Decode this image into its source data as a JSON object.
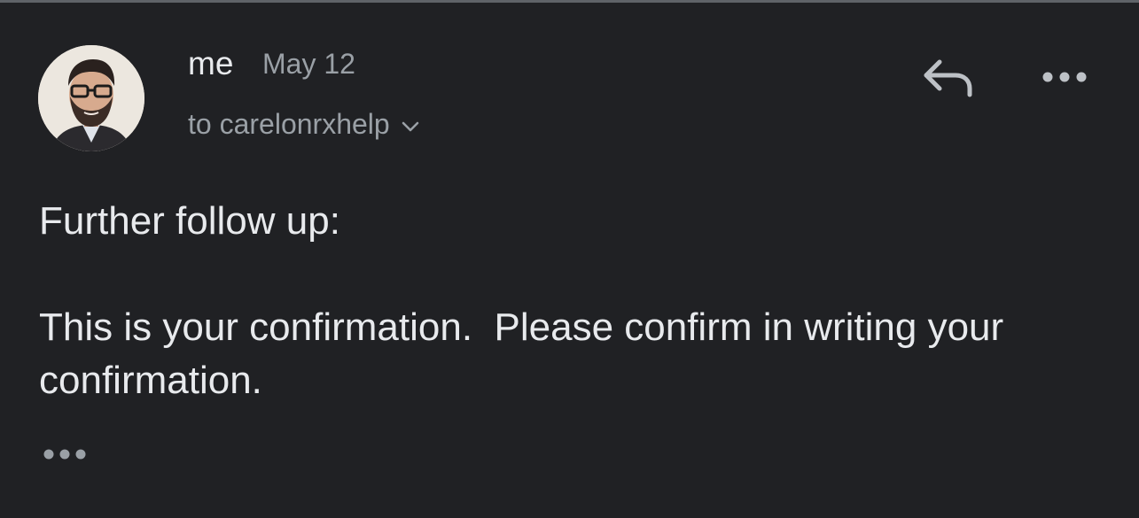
{
  "message": {
    "sender": "me",
    "date": "May 12",
    "recipient_line": "to carelonrxhelp",
    "body": {
      "line1": "Further follow up:",
      "paragraph2": "This is your confirmation.  Please confirm in writing your confirmation."
    }
  },
  "icons": {
    "reply": "reply-icon",
    "more": "more-options-icon",
    "expand": "chevron-down-icon",
    "trimmed": "show-trimmed-content-icon"
  },
  "colors": {
    "background": "#202124",
    "primary_text": "#e8eaed",
    "secondary_text": "#9aa0a6"
  }
}
